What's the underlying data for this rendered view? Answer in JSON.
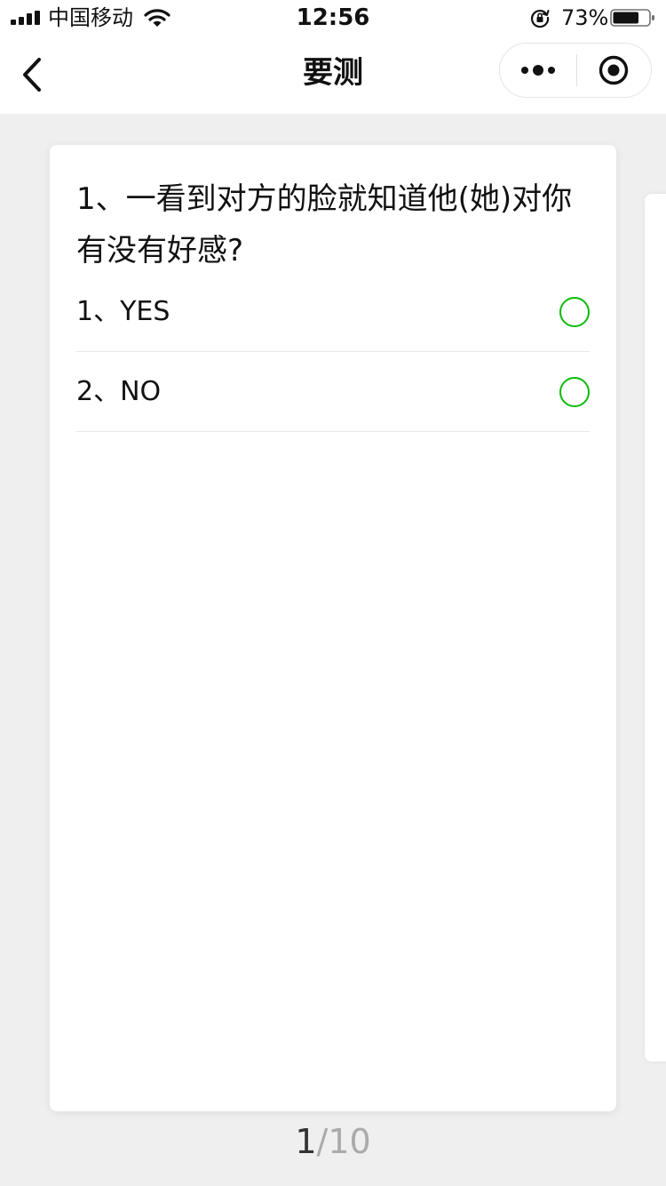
{
  "status_bar": {
    "carrier": "中国移动",
    "time": "12:56",
    "battery_percent": "73%",
    "battery_level": 0.73,
    "icons": [
      "signal-icon",
      "wifi-icon",
      "rotation-lock-icon",
      "battery-icon"
    ]
  },
  "nav": {
    "title": "要测",
    "icons": [
      "back-icon",
      "more-dots-icon",
      "close-target-icon"
    ]
  },
  "question": {
    "text": "1、一看到对方的脸就知道他(她)对你有没有好感?",
    "options": [
      {
        "label": "1、YES",
        "selected": false
      },
      {
        "label": "2、NO",
        "selected": false
      }
    ]
  },
  "pager": {
    "current": "1",
    "separator": "/",
    "total": "10"
  },
  "colors": {
    "accent_green": "#09bb07",
    "background": "#efefef",
    "card": "#ffffff"
  }
}
